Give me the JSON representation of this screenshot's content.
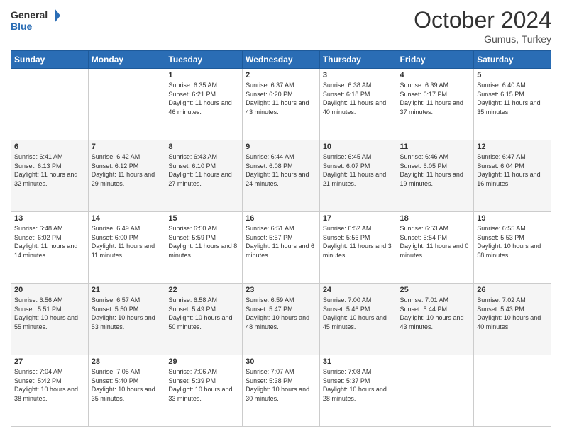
{
  "logo": {
    "line1": "General",
    "line2": "Blue"
  },
  "header": {
    "month": "October 2024",
    "location": "Gumus, Turkey"
  },
  "weekdays": [
    "Sunday",
    "Monday",
    "Tuesday",
    "Wednesday",
    "Thursday",
    "Friday",
    "Saturday"
  ],
  "weeks": [
    [
      {
        "day": "",
        "sunrise": "",
        "sunset": "",
        "daylight": ""
      },
      {
        "day": "",
        "sunrise": "",
        "sunset": "",
        "daylight": ""
      },
      {
        "day": "1",
        "sunrise": "Sunrise: 6:35 AM",
        "sunset": "Sunset: 6:21 PM",
        "daylight": "Daylight: 11 hours and 46 minutes."
      },
      {
        "day": "2",
        "sunrise": "Sunrise: 6:37 AM",
        "sunset": "Sunset: 6:20 PM",
        "daylight": "Daylight: 11 hours and 43 minutes."
      },
      {
        "day": "3",
        "sunrise": "Sunrise: 6:38 AM",
        "sunset": "Sunset: 6:18 PM",
        "daylight": "Daylight: 11 hours and 40 minutes."
      },
      {
        "day": "4",
        "sunrise": "Sunrise: 6:39 AM",
        "sunset": "Sunset: 6:17 PM",
        "daylight": "Daylight: 11 hours and 37 minutes."
      },
      {
        "day": "5",
        "sunrise": "Sunrise: 6:40 AM",
        "sunset": "Sunset: 6:15 PM",
        "daylight": "Daylight: 11 hours and 35 minutes."
      }
    ],
    [
      {
        "day": "6",
        "sunrise": "Sunrise: 6:41 AM",
        "sunset": "Sunset: 6:13 PM",
        "daylight": "Daylight: 11 hours and 32 minutes."
      },
      {
        "day": "7",
        "sunrise": "Sunrise: 6:42 AM",
        "sunset": "Sunset: 6:12 PM",
        "daylight": "Daylight: 11 hours and 29 minutes."
      },
      {
        "day": "8",
        "sunrise": "Sunrise: 6:43 AM",
        "sunset": "Sunset: 6:10 PM",
        "daylight": "Daylight: 11 hours and 27 minutes."
      },
      {
        "day": "9",
        "sunrise": "Sunrise: 6:44 AM",
        "sunset": "Sunset: 6:08 PM",
        "daylight": "Daylight: 11 hours and 24 minutes."
      },
      {
        "day": "10",
        "sunrise": "Sunrise: 6:45 AM",
        "sunset": "Sunset: 6:07 PM",
        "daylight": "Daylight: 11 hours and 21 minutes."
      },
      {
        "day": "11",
        "sunrise": "Sunrise: 6:46 AM",
        "sunset": "Sunset: 6:05 PM",
        "daylight": "Daylight: 11 hours and 19 minutes."
      },
      {
        "day": "12",
        "sunrise": "Sunrise: 6:47 AM",
        "sunset": "Sunset: 6:04 PM",
        "daylight": "Daylight: 11 hours and 16 minutes."
      }
    ],
    [
      {
        "day": "13",
        "sunrise": "Sunrise: 6:48 AM",
        "sunset": "Sunset: 6:02 PM",
        "daylight": "Daylight: 11 hours and 14 minutes."
      },
      {
        "day": "14",
        "sunrise": "Sunrise: 6:49 AM",
        "sunset": "Sunset: 6:00 PM",
        "daylight": "Daylight: 11 hours and 11 minutes."
      },
      {
        "day": "15",
        "sunrise": "Sunrise: 6:50 AM",
        "sunset": "Sunset: 5:59 PM",
        "daylight": "Daylight: 11 hours and 8 minutes."
      },
      {
        "day": "16",
        "sunrise": "Sunrise: 6:51 AM",
        "sunset": "Sunset: 5:57 PM",
        "daylight": "Daylight: 11 hours and 6 minutes."
      },
      {
        "day": "17",
        "sunrise": "Sunrise: 6:52 AM",
        "sunset": "Sunset: 5:56 PM",
        "daylight": "Daylight: 11 hours and 3 minutes."
      },
      {
        "day": "18",
        "sunrise": "Sunrise: 6:53 AM",
        "sunset": "Sunset: 5:54 PM",
        "daylight": "Daylight: 11 hours and 0 minutes."
      },
      {
        "day": "19",
        "sunrise": "Sunrise: 6:55 AM",
        "sunset": "Sunset: 5:53 PM",
        "daylight": "Daylight: 10 hours and 58 minutes."
      }
    ],
    [
      {
        "day": "20",
        "sunrise": "Sunrise: 6:56 AM",
        "sunset": "Sunset: 5:51 PM",
        "daylight": "Daylight: 10 hours and 55 minutes."
      },
      {
        "day": "21",
        "sunrise": "Sunrise: 6:57 AM",
        "sunset": "Sunset: 5:50 PM",
        "daylight": "Daylight: 10 hours and 53 minutes."
      },
      {
        "day": "22",
        "sunrise": "Sunrise: 6:58 AM",
        "sunset": "Sunset: 5:49 PM",
        "daylight": "Daylight: 10 hours and 50 minutes."
      },
      {
        "day": "23",
        "sunrise": "Sunrise: 6:59 AM",
        "sunset": "Sunset: 5:47 PM",
        "daylight": "Daylight: 10 hours and 48 minutes."
      },
      {
        "day": "24",
        "sunrise": "Sunrise: 7:00 AM",
        "sunset": "Sunset: 5:46 PM",
        "daylight": "Daylight: 10 hours and 45 minutes."
      },
      {
        "day": "25",
        "sunrise": "Sunrise: 7:01 AM",
        "sunset": "Sunset: 5:44 PM",
        "daylight": "Daylight: 10 hours and 43 minutes."
      },
      {
        "day": "26",
        "sunrise": "Sunrise: 7:02 AM",
        "sunset": "Sunset: 5:43 PM",
        "daylight": "Daylight: 10 hours and 40 minutes."
      }
    ],
    [
      {
        "day": "27",
        "sunrise": "Sunrise: 7:04 AM",
        "sunset": "Sunset: 5:42 PM",
        "daylight": "Daylight: 10 hours and 38 minutes."
      },
      {
        "day": "28",
        "sunrise": "Sunrise: 7:05 AM",
        "sunset": "Sunset: 5:40 PM",
        "daylight": "Daylight: 10 hours and 35 minutes."
      },
      {
        "day": "29",
        "sunrise": "Sunrise: 7:06 AM",
        "sunset": "Sunset: 5:39 PM",
        "daylight": "Daylight: 10 hours and 33 minutes."
      },
      {
        "day": "30",
        "sunrise": "Sunrise: 7:07 AM",
        "sunset": "Sunset: 5:38 PM",
        "daylight": "Daylight: 10 hours and 30 minutes."
      },
      {
        "day": "31",
        "sunrise": "Sunrise: 7:08 AM",
        "sunset": "Sunset: 5:37 PM",
        "daylight": "Daylight: 10 hours and 28 minutes."
      },
      {
        "day": "",
        "sunrise": "",
        "sunset": "",
        "daylight": ""
      },
      {
        "day": "",
        "sunrise": "",
        "sunset": "",
        "daylight": ""
      }
    ]
  ]
}
